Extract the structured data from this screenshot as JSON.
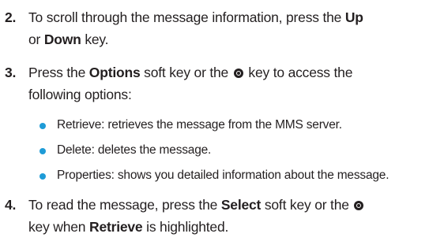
{
  "steps": [
    {
      "number": "2.",
      "line1_a": "To scroll through the message information, press the ",
      "line1_b": "Up",
      "line2_a": "or ",
      "line2_b": "Down",
      "line2_c": " key."
    },
    {
      "number": "3.",
      "line1_a": "Press the ",
      "line1_b": "Options",
      "line1_c": " soft key or the ",
      "line1_d": " key to access the",
      "line2": "following options:"
    },
    {
      "number": "4.",
      "line1_a": "To read the message, press the ",
      "line1_b": "Select",
      "line1_c": " soft key or the ",
      "line2_a": "key when ",
      "line2_b": "Retrieve",
      "line2_c": " is highlighted."
    }
  ],
  "options": [
    "Retrieve: retrieves the message from the MMS server.",
    "Delete: deletes the message.",
    "Properties: shows you detailed information about the message."
  ],
  "icons": {
    "ok_key": "ok-key-icon",
    "bullet": "bullet-dot-icon"
  },
  "colors": {
    "bullet": "#1e9bd7",
    "text": "#231f20"
  }
}
